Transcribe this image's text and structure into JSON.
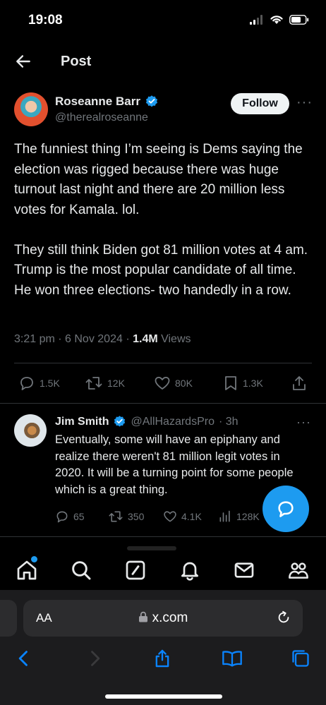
{
  "status_bar": {
    "time": "19:08"
  },
  "header": {
    "title": "Post"
  },
  "tweet": {
    "author_name": "Roseanne Barr",
    "author_handle": "@therealroseanne",
    "follow_label": "Follow",
    "more": "···",
    "text": "The funniest thing I’m seeing is Dems saying the election was rigged because there was huge turnout last night and there are 20 million less votes for Kamala. lol.\n\nThey still think Biden got 81 million votes at 4 am. Trump is the most popular candidate of all time. He won three elections- two handedly in a row.",
    "timestamp": "3:21 pm · 6 Nov 2024 · ",
    "views_count": "1.4M",
    "views_label": " Views",
    "replies": "1.5K",
    "reposts": "12K",
    "likes": "80K",
    "bookmarks": "1.3K"
  },
  "reply": {
    "author_name": "Jim Smith",
    "author_handle": "@AllHazardsPro",
    "time": "· 3h",
    "more": "···",
    "text": "Eventually, some will have an epiphany and realize there weren't 81 million legit votes in 2020. It will be a turning point for some people which is a great thing.",
    "replies": "65",
    "reposts": "350",
    "likes": "4.1K",
    "views": "128K"
  },
  "colors": {
    "accent": "#1d9bf0",
    "background": "#000000",
    "muted": "#71767b",
    "verified": "#1d9bf0"
  },
  "bottom_nav": [
    "home-icon",
    "search-icon",
    "grok-icon",
    "notifications-icon",
    "messages-icon",
    "communities-icon"
  ],
  "browser": {
    "aa_label": "AA",
    "url": "x.com"
  }
}
